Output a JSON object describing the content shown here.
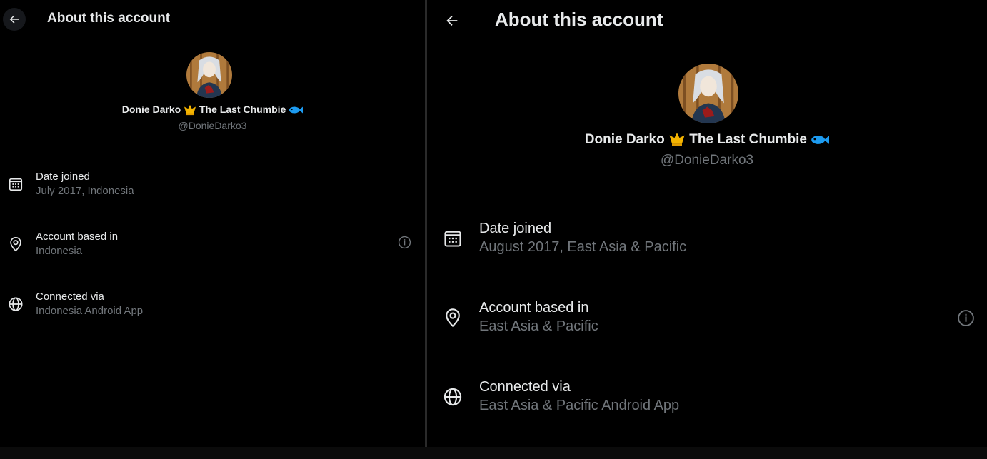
{
  "left": {
    "title": "About this account",
    "profile": {
      "name": "Donie Darko",
      "name_suffix": "The Last Chumbie",
      "handle": "@DonieDarko3"
    },
    "rows": [
      {
        "label": "Date joined",
        "value": "July 2017, Indonesia",
        "icon": "calendar-icon"
      },
      {
        "label": "Account based in",
        "value": "Indonesia",
        "icon": "location-pin-icon"
      },
      {
        "label": "Connected via",
        "value": "Indonesia Android App",
        "icon": "globe-icon"
      }
    ]
  },
  "right": {
    "title": "About this account",
    "profile": {
      "name": "Donie Darko",
      "name_suffix": "The Last Chumbie",
      "handle": "@DonieDarko3"
    },
    "rows": [
      {
        "label": "Date joined",
        "value": "August 2017, East Asia & Pacific",
        "icon": "calendar-icon"
      },
      {
        "label": "Account based in",
        "value": "East Asia & Pacific",
        "icon": "location-pin-icon"
      },
      {
        "label": "Connected via",
        "value": "East Asia & Pacific Android App",
        "icon": "globe-icon"
      }
    ]
  },
  "colors": {
    "background": "#000000",
    "primary_text": "#e7e9ea",
    "secondary_text": "#71767b",
    "crown_emoji": "#f4b400",
    "fish_emoji": "#1d9bf0"
  }
}
